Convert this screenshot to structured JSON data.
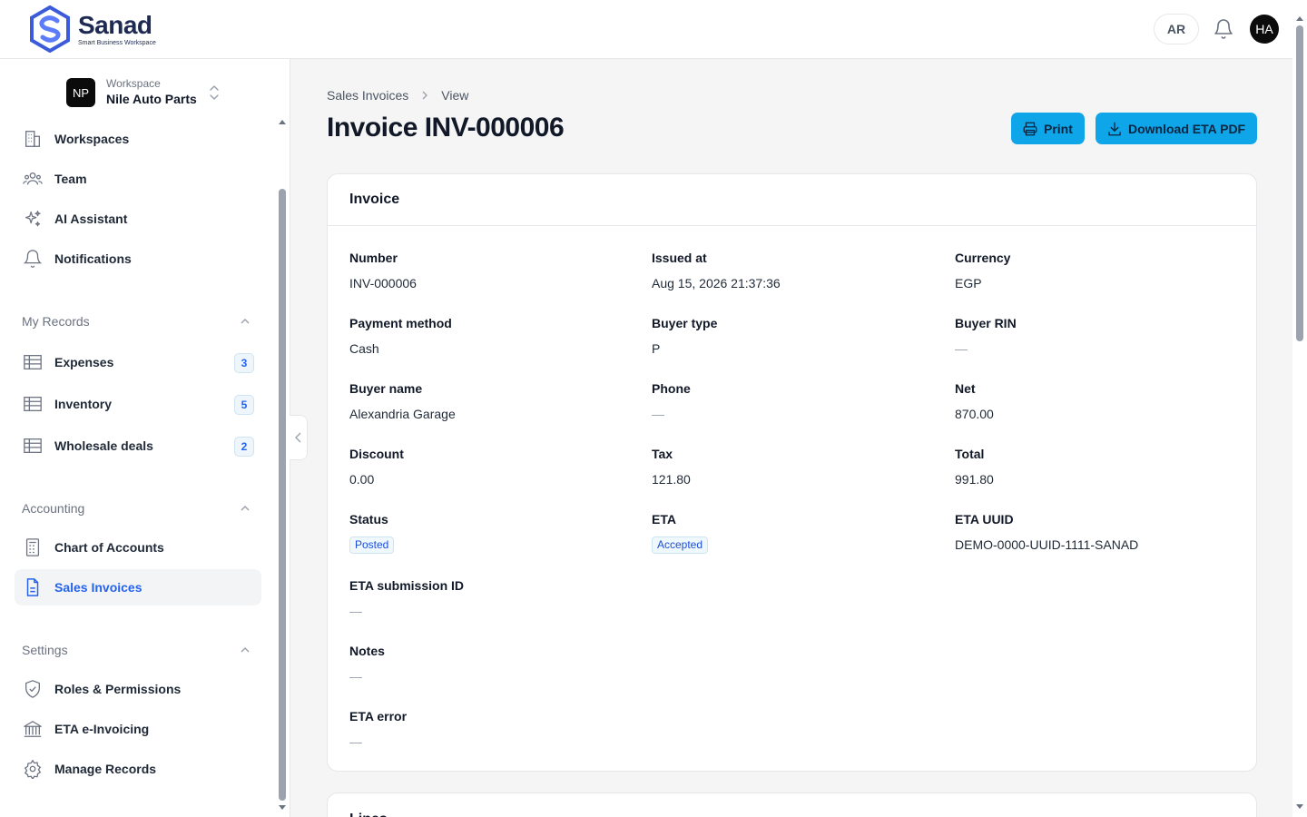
{
  "brand": {
    "name": "Sanad",
    "tagline": "Smart Business Workspace"
  },
  "topbar": {
    "language": "AR",
    "user_initials": "HA"
  },
  "workspace": {
    "label": "Workspace",
    "name": "Nile Auto Parts",
    "initials": "NP"
  },
  "nav": {
    "main": [
      {
        "label": "Workspaces",
        "icon": "building-icon"
      },
      {
        "label": "Team",
        "icon": "users-icon"
      },
      {
        "label": "AI Assistant",
        "icon": "sparkles-icon"
      },
      {
        "label": "Notifications",
        "icon": "bell-icon"
      }
    ],
    "my_records": {
      "title": "My Records",
      "items": [
        {
          "label": "Expenses",
          "count": "3",
          "icon": "table-icon"
        },
        {
          "label": "Inventory",
          "count": "5",
          "icon": "table-icon"
        },
        {
          "label": "Wholesale deals",
          "count": "2",
          "icon": "table-icon"
        }
      ]
    },
    "accounting": {
      "title": "Accounting",
      "items": [
        {
          "label": "Chart of Accounts",
          "icon": "ledger-icon"
        },
        {
          "label": "Sales Invoices",
          "icon": "document-icon",
          "active": true
        }
      ]
    },
    "settings": {
      "title": "Settings",
      "items": [
        {
          "label": "Roles & Permissions",
          "icon": "shield-icon"
        },
        {
          "label": "ETA e-Invoicing",
          "icon": "bank-icon"
        },
        {
          "label": "Manage Records",
          "icon": "gear-icon"
        }
      ]
    }
  },
  "breadcrumb": {
    "parent": "Sales Invoices",
    "current": "View"
  },
  "page": {
    "title": "Invoice INV-000006"
  },
  "actions": {
    "print": "Print",
    "download": "Download ETA PDF"
  },
  "invoice": {
    "heading": "Invoice",
    "fields": {
      "number": {
        "label": "Number",
        "value": "INV-000006"
      },
      "issued_at": {
        "label": "Issued at",
        "value": "Aug 15, 2026 21:37:36"
      },
      "currency": {
        "label": "Currency",
        "value": "EGP"
      },
      "payment_method": {
        "label": "Payment method",
        "value": "Cash"
      },
      "buyer_type": {
        "label": "Buyer type",
        "value": "P"
      },
      "buyer_rin": {
        "label": "Buyer RIN",
        "value": "—"
      },
      "buyer_name": {
        "label": "Buyer name",
        "value": "Alexandria Garage"
      },
      "phone": {
        "label": "Phone",
        "value": "—"
      },
      "net": {
        "label": "Net",
        "value": "870.00"
      },
      "discount": {
        "label": "Discount",
        "value": "0.00"
      },
      "tax": {
        "label": "Tax",
        "value": "121.80"
      },
      "total": {
        "label": "Total",
        "value": "991.80"
      },
      "status": {
        "label": "Status",
        "value": "Posted"
      },
      "eta": {
        "label": "ETA",
        "value": "Accepted"
      },
      "eta_uuid": {
        "label": "ETA UUID",
        "value": "DEMO-0000-UUID-1111-SANAD"
      },
      "eta_submission_id": {
        "label": "ETA submission ID",
        "value": "—"
      },
      "notes": {
        "label": "Notes",
        "value": "—"
      },
      "eta_error": {
        "label": "ETA error",
        "value": "—"
      }
    }
  },
  "lines": {
    "heading": "Lines"
  },
  "colors": {
    "accent": "#0ea5e9",
    "active_link": "#2563eb",
    "brand": "#1e2a52"
  }
}
